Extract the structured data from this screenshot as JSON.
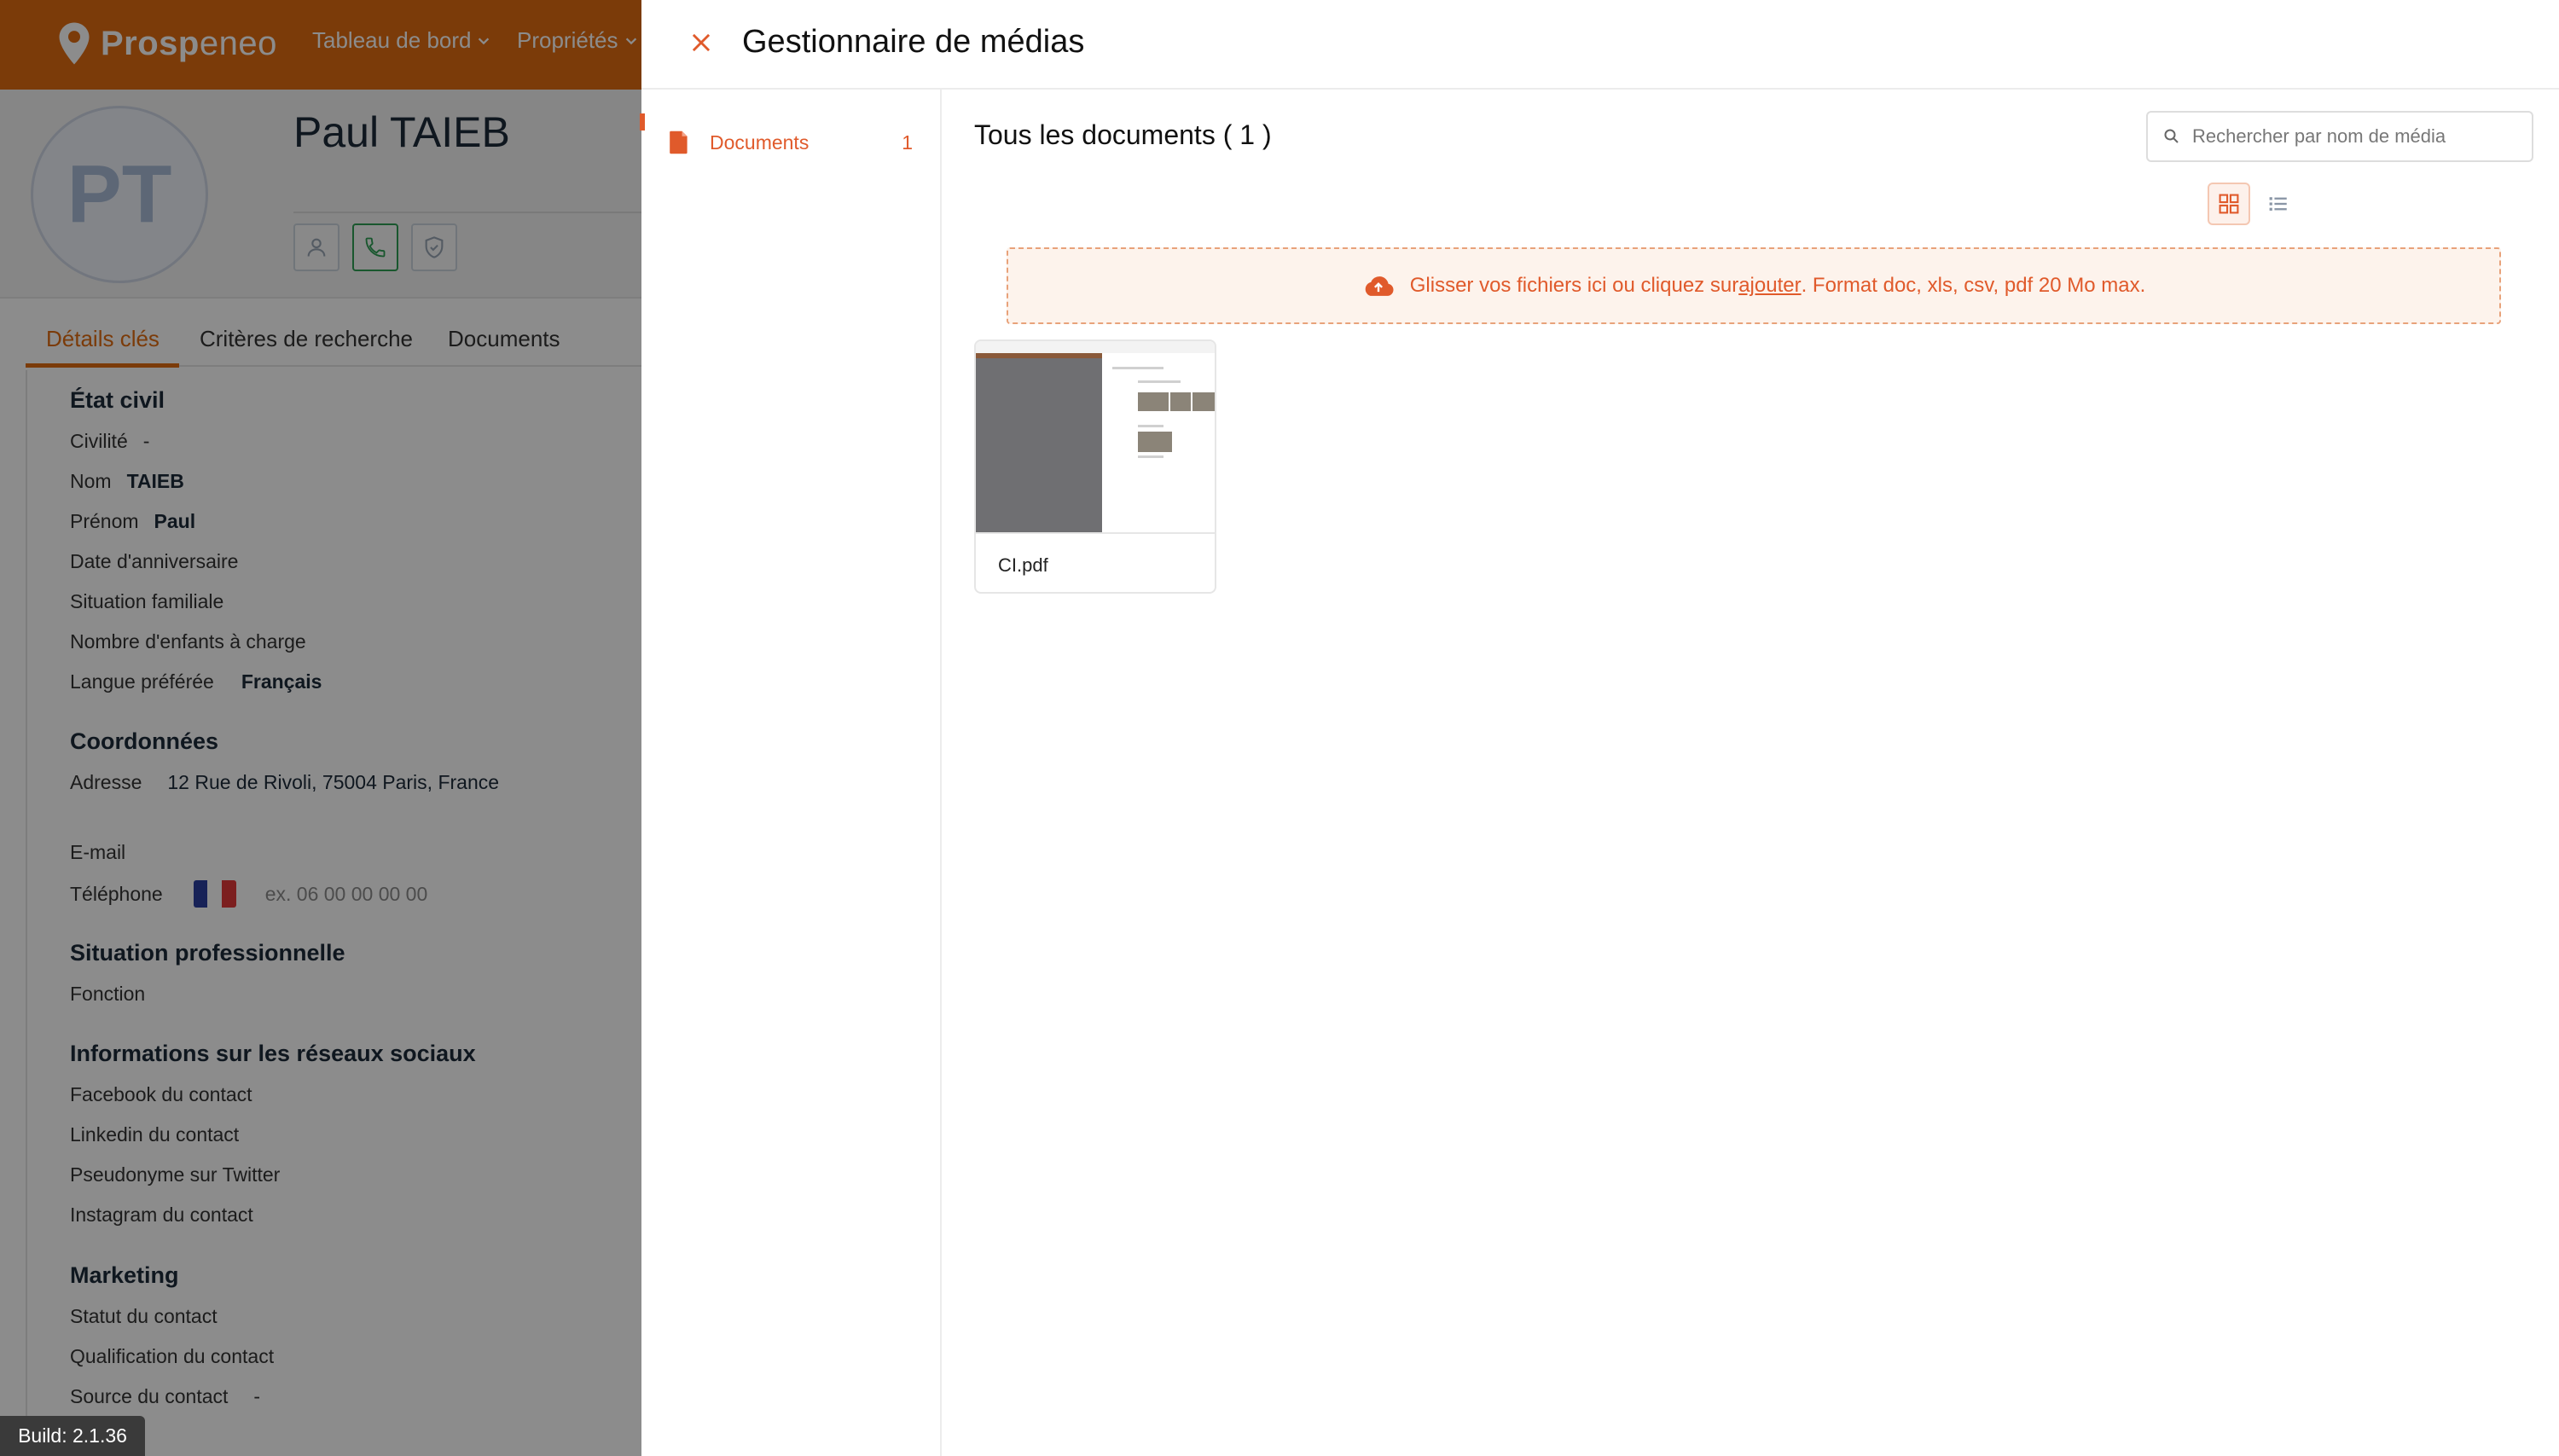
{
  "app": {
    "brand": "Prospeneo",
    "brand_prefix": "Prosp",
    "brand_suffix": "eneo",
    "accent_color": "#e06c12",
    "nav": [
      {
        "label": "Tableau de bord",
        "icon": "chevron-down-icon"
      },
      {
        "label": "Propriétés",
        "icon": "chevron-down-icon"
      }
    ],
    "contact": {
      "initials": "PT",
      "name": "Paul TAIEB",
      "actions": [
        {
          "icon": "person-icon"
        },
        {
          "icon": "phone-icon"
        },
        {
          "icon": "shield-icon"
        }
      ]
    },
    "tabs": [
      "Détails clés",
      "Critères de recherche",
      "Documents"
    ],
    "sections": {
      "civil": {
        "title": "État civil",
        "civilite_label": "Civilité",
        "civilite_value": "-",
        "nom_label": "Nom",
        "nom_value": "TAIEB",
        "prenom_label": "Prénom",
        "prenom_value": "Paul",
        "anniversaire_label": "Date d'anniversaire",
        "situation_label": "Situation familiale",
        "enfants_label": "Nombre d'enfants à charge",
        "langue_label": "Langue préférée",
        "langue_value": "Français"
      },
      "coordonnees": {
        "title": "Coordonnées",
        "adresse_label": "Adresse",
        "adresse_value": "12 Rue de Rivoli, 75004 Paris, France",
        "email_label": "E-mail",
        "telephone_label": "Téléphone",
        "telephone_placeholder": "ex. 06 00 00 00 00"
      },
      "pro": {
        "title": "Situation professionnelle",
        "fonction_label": "Fonction"
      },
      "social": {
        "title": "Informations sur les réseaux sociaux",
        "facebook_label": "Facebook du contact",
        "linkedin_label": "Linkedin du contact",
        "twitter_label": "Pseudonyme sur Twitter",
        "instagram_label": "Instagram du contact"
      },
      "marketing": {
        "title": "Marketing",
        "statut_label": "Statut du contact",
        "qualification_label": "Qualification du contact",
        "source_label": "Source du contact",
        "source_value": "-"
      }
    },
    "build": "Build: 2.1.36"
  },
  "media_manager": {
    "title": "Gestionnaire de médias",
    "close_icon": "close-icon",
    "accent_color": "#e05a2b",
    "sidebar": [
      {
        "label": "Documents",
        "count": "1",
        "icon": "document-icon"
      }
    ],
    "content_title": "Tous les documents ( 1 )",
    "search_placeholder": "Rechercher par nom de média",
    "view_modes": [
      {
        "icon": "grid-view-icon",
        "active": true
      },
      {
        "icon": "list-view-icon",
        "active": false
      }
    ],
    "dropzone": {
      "text_before": "Glisser vos fichiers ici ou cliquez sur ",
      "link": "ajouter",
      "text_after": ". Format doc, xls, csv, pdf 20 Mo max.",
      "icon": "upload-cloud-icon"
    },
    "files": [
      {
        "name": "CI.pdf"
      }
    ]
  }
}
